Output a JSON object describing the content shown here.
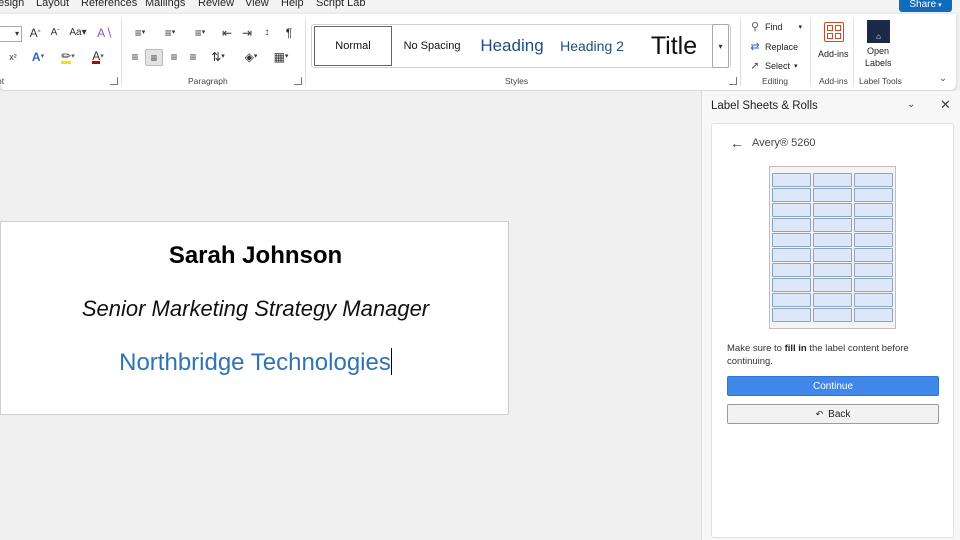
{
  "menu": {
    "items": [
      "esign",
      "Layout",
      "References",
      "Mailings",
      "Review",
      "View",
      "Help",
      "Script Lab"
    ],
    "share_label": "Share"
  },
  "ribbon": {
    "groups": {
      "font_partial": "nt",
      "paragraph": "Paragraph",
      "styles": "Styles",
      "editing": "Editing",
      "addins": "Add-ins",
      "label_tools": "Label Tools"
    },
    "styles_gallery": [
      "Normal",
      "No Spacing",
      "Heading",
      "Heading 2",
      "Title"
    ],
    "editing": {
      "find": "Find",
      "replace": "Replace",
      "select": "Select"
    },
    "addins_button": "Add-ins",
    "open_labels": [
      "Open",
      "Labels"
    ]
  },
  "document": {
    "name": "Sarah Johnson",
    "title": "Senior Marketing Strategy Manager",
    "company": "Northbridge Technologies"
  },
  "pane": {
    "title": "Label Sheets & Rolls",
    "product": "Avery® 5260",
    "instruction_pre": "Make sure to ",
    "instruction_bold": "fill in",
    "instruction_post": " the label content before continuing.",
    "continue_label": "Continue",
    "back_label": "Back"
  },
  "colors": {
    "accent": "#0f6cbd",
    "continue_button": "#3f87e8",
    "company_text": "#2e74b5",
    "heading_style": "#1f4e79"
  }
}
